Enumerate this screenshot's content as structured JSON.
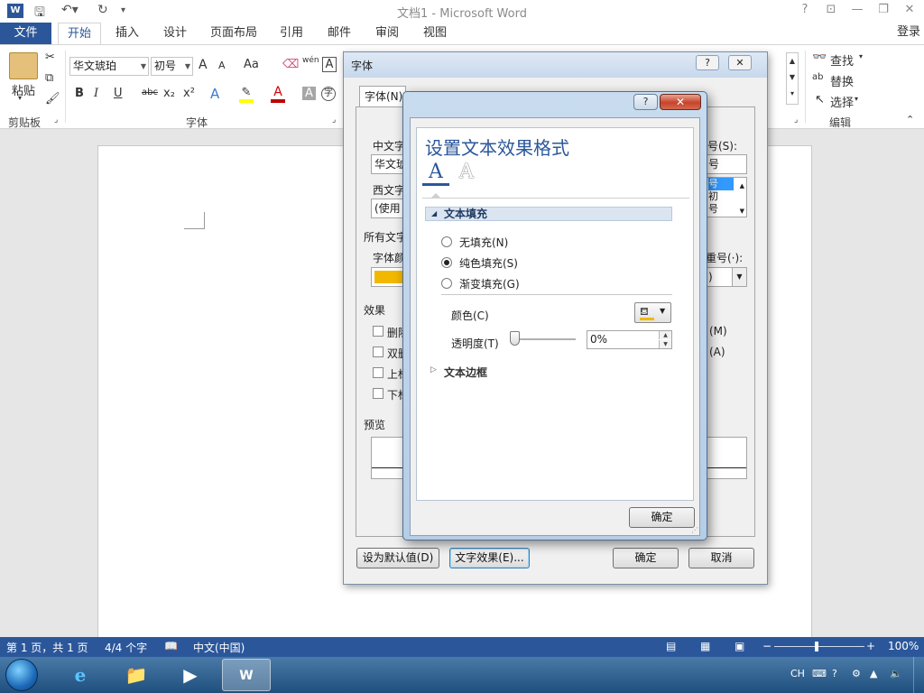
{
  "titlebar": {
    "title": "文档1 - Microsoft Word",
    "app_icon": "W",
    "help": "?",
    "restore_ribbon": "⊡",
    "minimize": "—",
    "maximize": "❐",
    "close": "✕"
  },
  "tabs": {
    "file": "文件",
    "items": [
      "开始",
      "插入",
      "设计",
      "页面布局",
      "引用",
      "邮件",
      "审阅",
      "视图"
    ],
    "active": "开始",
    "login": "登录"
  },
  "ribbon": {
    "clipboard": {
      "paste": "粘贴",
      "label": "剪贴板"
    },
    "font": {
      "label": "字体",
      "font_name": "华文琥珀",
      "font_size": "初号",
      "grow": "A",
      "shrink": "A",
      "case": "Aa",
      "bold": "B",
      "italic": "I",
      "underline": "U",
      "strike": "abc",
      "sub": "x₂",
      "sup": "x²",
      "pinyin": "wén"
    },
    "editing": {
      "label": "编辑",
      "find": "查找",
      "replace": "替换",
      "select": "选择"
    }
  },
  "font_dialog": {
    "title": "字体",
    "tab_font": "字体(N)",
    "cn_font_label": "中文字",
    "cn_font_value": "华文琥",
    "west_font_label": "西文字",
    "west_font_value": "(使用",
    "all_text_label": "所有文字",
    "font_color_label": "字体颜",
    "effects_label": "效果",
    "effects": [
      "删除",
      "双删",
      "上标",
      "下标"
    ],
    "size_label": "号(S):",
    "size_value": "号",
    "size_list": [
      "号",
      "初",
      "号"
    ],
    "emphasis_label": "重号(·):",
    "emphasis_value": ")",
    "opt_m": "(M)",
    "opt_a": "(A)",
    "preview_label": "预览",
    "btn_default": "设为默认值(D)",
    "btn_text_effects": "文字效果(E)...",
    "btn_ok": "确定",
    "btn_cancel": "取消",
    "help": "?",
    "close": "✕",
    "font_color_swatch": "#f2b800"
  },
  "fx_dialog": {
    "heading": "设置文本效果格式",
    "help": "?",
    "close": "✕",
    "icon_fill": "A",
    "icon_outline": "A",
    "section_fill": "文本填充",
    "opt_none": "无填充(N)",
    "opt_solid": "纯色填充(S)",
    "opt_gradient": "渐变填充(G)",
    "selected": "纯色填充(S)",
    "color_label": "颜色(C)",
    "transparency_label": "透明度(T)",
    "transparency_value": "0%",
    "transparency_level": 0,
    "section_border": "文本边框",
    "ok": "确定",
    "accent_color": "#2b579a",
    "fill_color": "#f2b800"
  },
  "statusbar": {
    "page": "第 1 页，共 1 页",
    "words": "4/4 个字",
    "language": "中文(中国)",
    "zoom": "100%"
  },
  "taskbar": {
    "lang": "CH",
    "apps": [
      "internet-explorer-icon",
      "file-explorer-icon",
      "media-player-icon",
      "word-icon"
    ]
  }
}
